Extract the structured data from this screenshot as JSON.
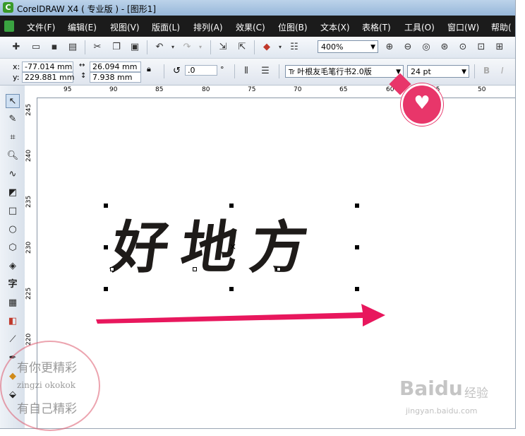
{
  "window": {
    "title": "CorelDRAW X4 ( 专业版 ) - [图形1]"
  },
  "menu": {
    "items": [
      "文件(F)",
      "编辑(E)",
      "视图(V)",
      "版面(L)",
      "排列(A)",
      "效果(C)",
      "位图(B)",
      "文本(X)",
      "表格(T)",
      "工具(O)",
      "窗口(W)",
      "帮助("
    ]
  },
  "toolbar": {
    "zoom_value": "400%",
    "icons": [
      "new-icon",
      "open-icon",
      "save-icon",
      "print-icon",
      "cut-icon",
      "copy-icon",
      "paste-icon",
      "undo-icon",
      "redo-icon",
      "import-icon",
      "export-icon",
      "launcher-icon",
      "welcome-icon",
      "zoom-in-icon",
      "zoom-out-icon",
      "zoom-selected-icon",
      "zoom-all-icon",
      "zoom-page-icon",
      "zoom-width-icon",
      "zoom-height-icon"
    ]
  },
  "propertybar": {
    "x_label": "x:",
    "x_value": "-77.014 mm",
    "y_label": "y:",
    "y_value": "229.881 mm",
    "width_value": "26.094 mm",
    "height_value": "7.938 mm",
    "rotation_value": ".0",
    "degree_symbol": "°",
    "font_name": "叶根友毛笔行书2.0版",
    "font_size": "24 pt",
    "bold_label": "B",
    "italic_label": "I"
  },
  "rulers": {
    "horizontal": [
      "95",
      "90",
      "85",
      "80",
      "75",
      "70",
      "65",
      "60",
      "55",
      "50"
    ],
    "vertical": [
      "245",
      "240",
      "235",
      "230",
      "225",
      "220"
    ]
  },
  "toolbox": {
    "text_tool_label": "字",
    "icons": [
      "pick-tool-icon",
      "shape-tool-icon",
      "crop-tool-icon",
      "zoom-tool-icon",
      "freehand-tool-icon",
      "smart-fill-icon",
      "rectangle-tool-icon",
      "ellipse-tool-icon",
      "polygon-tool-icon",
      "basic-shapes-icon",
      "text-tool-icon",
      "table-tool-icon",
      "interactive-tool-icon",
      "eyedropper-icon",
      "outline-icon",
      "fill-icon"
    ]
  },
  "canvas": {
    "text_art": "好地方"
  },
  "annotations": {
    "arrow_color": "#e8175d",
    "badge_color": "#e8366a"
  },
  "watermark": {
    "stamp_line1": "有你更精彩",
    "stamp_line2": "zingzi okokok",
    "stamp_line3": "有自己精彩",
    "baidu": "Baidu",
    "baidu_cn": "经验",
    "baidu_url": "jingyan.baidu.com"
  }
}
